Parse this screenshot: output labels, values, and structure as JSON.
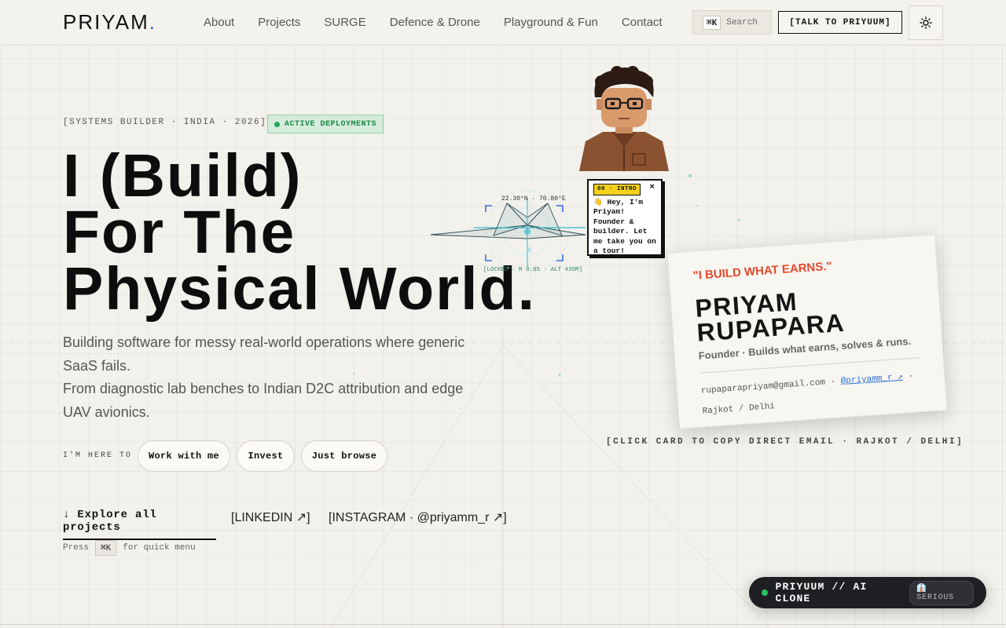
{
  "nav": {
    "logo": "PRIYAM",
    "logo_dot": ".",
    "links": [
      "About",
      "Projects",
      "SURGE",
      "Defence & Drone",
      "Playground & Fun",
      "Contact"
    ],
    "search_kbd": "⌘K",
    "search_label": "Search",
    "talk_label": "[TALK TO PRIYUUM]",
    "theme_icon": "sun-icon"
  },
  "hero": {
    "tagline": "[SYSTEMS BUILDER · INDIA · 2026]",
    "badge": "ACTIVE DEPLOYMENTS",
    "headline_lines": [
      "I (Build)",
      "For The",
      "Physical World."
    ],
    "sub_lines": [
      "Building software for messy real-world operations where generic SaaS fails.",
      "From diagnostic lab benches to Indian D2C attribution and edge UAV avionics."
    ],
    "here_label": "I'M HERE TO",
    "pills": [
      "Work with me",
      "Invest",
      "Just browse"
    ],
    "explore": "↓ Explore all projects",
    "linkedin": "[LINKEDIN ↗]",
    "instagram": "[INSTAGRAM · @priyamm_r ↗]",
    "press_prefix": "Press",
    "press_kbd": "⌘K",
    "press_suffix": "for quick menu"
  },
  "drone": {
    "coords": "22.30°N · 70.80°E",
    "lock": "[LOCKED · M 0.85 · ALT 439M]"
  },
  "bubble": {
    "tag": "00 · INTRO",
    "close": "×",
    "message": "👋 Hey, I'm Priyam! Founder & builder. Let me take you on a tour!"
  },
  "card": {
    "quote": "\"I BUILD WHAT EARNS.\"",
    "name_line1": "PRIYAM",
    "name_line2": "RUPAPARA",
    "role": "Founder · Builds what earns, solves & runs.",
    "email": "rupaparapriyam@gmail.com",
    "sep": "·",
    "instagram": "@priyamm_r ↗",
    "location": "Rajkot / Delhi",
    "caption": "[CLICK CARD TO COPY DIRECT EMAIL · RAJKOT / DELHI]"
  },
  "clone": {
    "title": "PRIYUUM // AI CLONE",
    "mode": "👔 SERIOUS"
  },
  "colors": {
    "background": "#f3f1ec",
    "accent_blue": "#2b5fd9",
    "active_green": "#1fa553",
    "quote_red": "#e44a2e",
    "bubble_yellow": "#f4d11b",
    "hud_cyan": "#3fc2d3"
  }
}
